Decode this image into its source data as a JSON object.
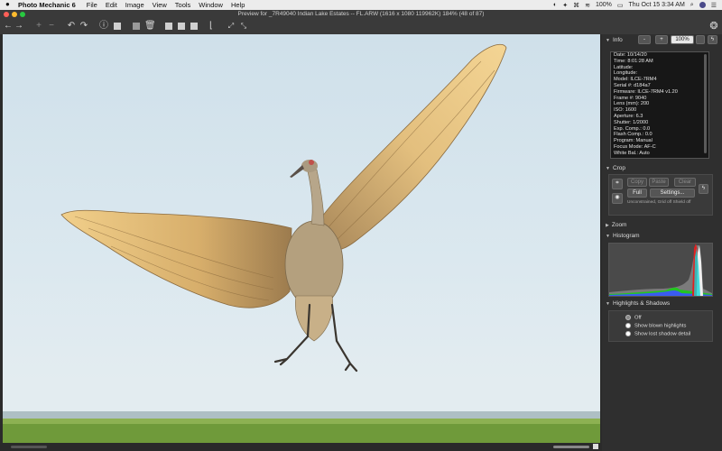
{
  "menubar": {
    "app": "Photo Mechanic 6",
    "items": [
      "File",
      "Edit",
      "Image",
      "View",
      "Tools",
      "Window",
      "Help"
    ],
    "battery": "100%",
    "clock": "Thu Oct 15  3:34 AM"
  },
  "window": {
    "title": "Preview for _7R49040 Indian Lake Estates -- FL.ARW (1616 x 1080 119962K) 184% (48 of 87)"
  },
  "panel": {
    "info": {
      "label": "Info",
      "minus": "-",
      "plus": "+",
      "zoom": "100%",
      "lines": [
        "Date: 10/14/20",
        "Time: 8:01:28 AM",
        "Latitude:",
        "Longitude:",
        "Model: ILCE-7RM4",
        "Serial #: d184a7",
        "Firmware: ILCE-7RM4 v1.20",
        "Frame #: 9040",
        "Lens (mm): 200",
        "ISO: 1600",
        "Aperture: 6.3",
        "Shutter: 1/2000",
        "Exp. Comp.: 0.0",
        "Flash Comp.: 0.0",
        "Program: Manual",
        "Focus Mode: AF-C",
        "White Bal.: Auto"
      ]
    },
    "crop": {
      "label": "Crop",
      "copy": "Copy",
      "paste": "Paste",
      "clear": "Clear",
      "full": "Full",
      "settings": "Settings...",
      "note": "Unconstrained, Grid off Shield off"
    },
    "zoom_label": "Zoom",
    "histogram_label": "Histogram",
    "highlights": {
      "label": "Highlights & Shadows",
      "options": [
        "Off",
        "Show blown highlights",
        "Show lost shadow detail"
      ],
      "selected": "Off"
    }
  },
  "colors": {
    "sky": "#d6e6ee",
    "panel_bg": "#2f2f2f",
    "toolbar_bg": "#3a3a3a",
    "bird_wing": "#e0bc7a",
    "grass": "#6f9a3a"
  }
}
